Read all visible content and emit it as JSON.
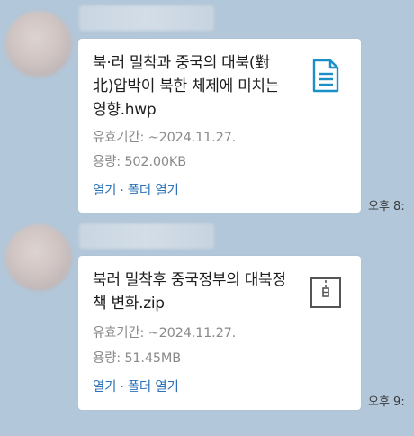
{
  "messages": [
    {
      "file_title": "북·러 밀착과 중국의 대북(對北)압박이 북한 체제에 미치는 영향.hwp",
      "expiry": "유효기간: ~2024.11.27.",
      "size": "용량: 502.00KB",
      "open_label": "열기",
      "separator": "·",
      "open_folder_label": "폴더 열기",
      "file_icon": "document-icon",
      "time": "오후 8:"
    },
    {
      "file_title": "북러 밀착후 중국정부의 대북정책 변화.zip",
      "expiry": "유효기간: ~2024.11.27.",
      "size": "용량: 51.45MB",
      "open_label": "열기",
      "separator": "·",
      "open_folder_label": "폴더 열기",
      "file_icon": "zip-archive-icon",
      "time": "오후 9:"
    }
  ],
  "colors": {
    "background": "#b2c7d9",
    "bubble": "#ffffff",
    "link": "#2c73b8",
    "doc_icon": "#1c8fc7",
    "zip_icon": "#555555"
  }
}
